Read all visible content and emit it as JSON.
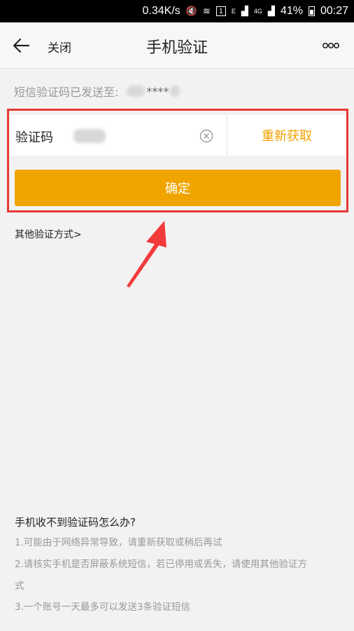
{
  "status_bar": {
    "speed": "0.34K/s",
    "sim_badge": "1",
    "net_e": "E",
    "net_4g": "4G",
    "battery": "41%",
    "time": "00:27"
  },
  "navbar": {
    "close_label": "关闭",
    "title": "手机验证"
  },
  "sent_notice": {
    "prefix": "短信验证码已发送至:",
    "masked_stars": "****"
  },
  "code_row": {
    "label": "验证码",
    "resend_label": "重新获取"
  },
  "confirm_label": "确定",
  "other_methods_label": "其他验证方式>",
  "help": {
    "title": "手机收不到验证码怎么办?",
    "line1": "1.可能由于网络异常导致，请重新获取或稍后再试",
    "line2a": "2.请核实手机是否屏蔽系统短信，若已停用或丢失，请使用其他验证方",
    "line2b": "式",
    "line3": "3.一个账号一天最多可以发送3条验证短信"
  },
  "colors": {
    "accent": "#f0a400",
    "resend": "#f0a100",
    "highlight_border": "#e53935",
    "arrow": "#f23a3a"
  },
  "icons": [
    "back-arrow-icon",
    "clear-icon",
    "more-icon",
    "annotation-arrow-icon"
  ]
}
